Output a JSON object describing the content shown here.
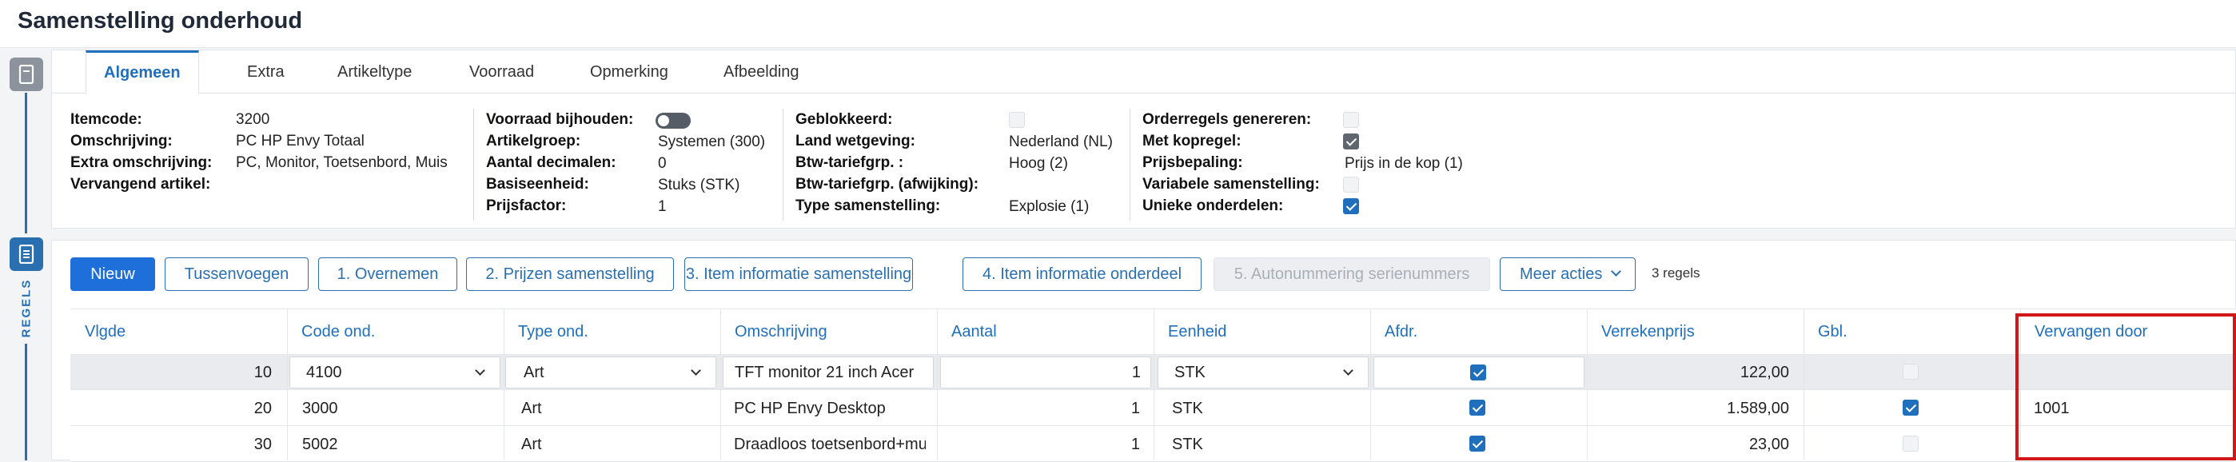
{
  "page": {
    "title": "Samenstelling onderhoud"
  },
  "rail": {
    "regels_label": "REGELS"
  },
  "tabs": [
    {
      "label": "Algemeen",
      "active": true
    },
    {
      "label": "Extra"
    },
    {
      "label": "Artikeltype"
    },
    {
      "label": "Voorraad"
    },
    {
      "label": "Opmerking"
    },
    {
      "label": "Afbeelding"
    }
  ],
  "fields": {
    "itemcode": {
      "label": "Itemcode:",
      "value": "3200"
    },
    "omschrijving": {
      "label": "Omschrijving:",
      "value": "PC HP Envy Totaal"
    },
    "extra_omschrijving": {
      "label": "Extra omschrijving:",
      "value": "PC, Monitor, Toetsenbord, Muis"
    },
    "vervangend_artikel": {
      "label": "Vervangend artikel:",
      "value": ""
    },
    "voorraad_bijhouden": {
      "label": "Voorraad bijhouden:",
      "value": false
    },
    "artikelgroep": {
      "label": "Artikelgroep:",
      "value": "Systemen (300)"
    },
    "aantal_decimalen": {
      "label": "Aantal decimalen:",
      "value": "0"
    },
    "basiseenheid": {
      "label": "Basiseenheid:",
      "value": "Stuks (STK)"
    },
    "prijsfactor": {
      "label": "Prijsfactor:",
      "value": "1"
    },
    "geblokkeerd": {
      "label": "Geblokkeerd:",
      "value": false
    },
    "land_wetgeving": {
      "label": "Land wetgeving:",
      "value": "Nederland (NL)"
    },
    "btw_tariefgrp": {
      "label": "Btw-tariefgrp. :",
      "value": "Hoog (2)"
    },
    "btw_tariefgrp_afwijking": {
      "label": "Btw-tariefgrp. (afwijking):",
      "value": ""
    },
    "type_samenstelling": {
      "label": "Type samenstelling:",
      "value": "Explosie (1)"
    },
    "orderregels_genereren": {
      "label": "Orderregels genereren:",
      "value": false
    },
    "met_kopregel": {
      "label": "Met kopregel:",
      "value": true
    },
    "prijsbepaling": {
      "label": "Prijsbepaling:",
      "value": "Prijs in de kop (1)"
    },
    "variabele_samenstelling": {
      "label": "Variabele samenstelling:",
      "value": false
    },
    "unieke_onderdelen": {
      "label": "Unieke onderdelen:",
      "value": true
    }
  },
  "toolbar": {
    "nieuw": "Nieuw",
    "tussenvoegen": "Tussenvoegen",
    "overnemen": "1. Overnemen",
    "prijzen": "2. Prijzen samenstelling",
    "item_info_samenstelling": "3. Item informatie samenstelling",
    "item_info_onderdeel": "4. Item informatie onderdeel",
    "autonummering": "5. Autonummering serienummers",
    "meer_acties": "Meer acties",
    "regels_count": "3 regels"
  },
  "table": {
    "columns": [
      "Vlgde",
      "Code ond.",
      "Type ond.",
      "Omschrijving",
      "Aantal",
      "Eenheid",
      "Afdr.",
      "Verrekenprijs",
      "Gbl.",
      "Vervangen door"
    ],
    "rows": [
      {
        "vlgde": "10",
        "code": "4100",
        "type": "Art",
        "omschrijving": "TFT monitor 21 inch Acer",
        "aantal": "1",
        "eenheid": "STK",
        "afdr": true,
        "verrekenprijs": "122,00",
        "gbl": false,
        "vervangen_door": ""
      },
      {
        "vlgde": "20",
        "code": "3000",
        "type": "Art",
        "omschrijving": "PC HP Envy Desktop",
        "aantal": "1",
        "eenheid": "STK",
        "afdr": true,
        "verrekenprijs": "1.589,00",
        "gbl": true,
        "vervangen_door": "1001"
      },
      {
        "vlgde": "30",
        "code": "5002",
        "type": "Art",
        "omschrijving": "Draadloos toetsenbord+muis",
        "aantal": "1",
        "eenheid": "STK",
        "afdr": true,
        "verrekenprijs": "23,00",
        "gbl": false,
        "vervangen_door": ""
      }
    ]
  }
}
